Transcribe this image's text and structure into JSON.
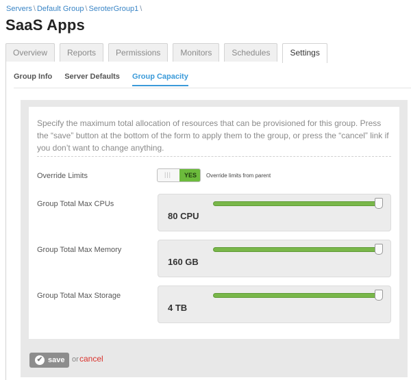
{
  "breadcrumb": {
    "items": [
      "Servers",
      "Default Group",
      "SeroterGroup1"
    ],
    "separator": "\\"
  },
  "page": {
    "title": "SaaS Apps"
  },
  "tabs": [
    {
      "label": "Overview",
      "active": false
    },
    {
      "label": "Reports",
      "active": false
    },
    {
      "label": "Permissions",
      "active": false
    },
    {
      "label": "Monitors",
      "active": false
    },
    {
      "label": "Schedules",
      "active": false
    },
    {
      "label": "Settings",
      "active": true
    }
  ],
  "subtabs": [
    {
      "label": "Group Info",
      "active": false
    },
    {
      "label": "Server Defaults",
      "active": false
    },
    {
      "label": "Group Capacity",
      "active": true
    }
  ],
  "form": {
    "intro": "Specify the maximum total allocation of resources that can be provisioned for this group. Press the “save” button at the bottom of the form to apply them to the group, or press the “cancel” link if you don’t want to change anything.",
    "override": {
      "label": "Override Limits",
      "grip": "|||",
      "toggle_value": "YES",
      "note": "Override limits from parent"
    },
    "limits": [
      {
        "label": "Group Total Max CPUs",
        "value": "80 CPU",
        "slider_fraction": 1.0
      },
      {
        "label": "Group Total Max Memory",
        "value": "160 GB",
        "slider_fraction": 1.0
      },
      {
        "label": "Group Total Max Storage",
        "value": "4 TB",
        "slider_fraction": 1.0
      }
    ]
  },
  "actions": {
    "save_label": "save",
    "or_text": "or",
    "cancel_label": "cancel",
    "check_icon": "✔"
  },
  "colors": {
    "accent": "#3a9ad9",
    "toggle_on": "#6cbb3c",
    "slider": "#79b74a",
    "cancel": "#d9312b"
  }
}
